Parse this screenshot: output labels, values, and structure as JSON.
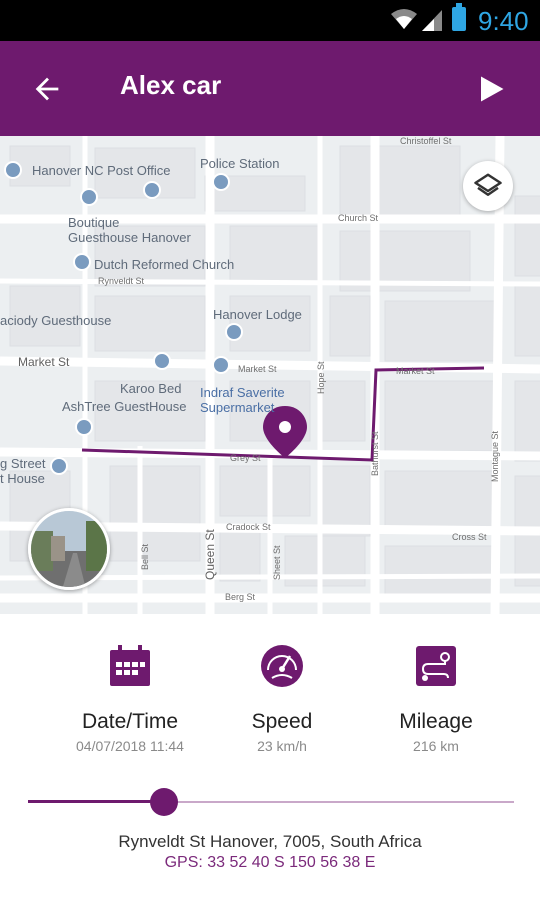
{
  "status_bar": {
    "time": "9:40",
    "icons": [
      "wifi-icon",
      "cell-signal-icon",
      "battery-icon"
    ]
  },
  "app_bar": {
    "title": "Alex car",
    "back_icon": "arrow-left-icon",
    "play_icon": "play-icon",
    "color": "#6e1a6e"
  },
  "map": {
    "layers_icon": "layers-icon",
    "pois": [
      {
        "name": "Hanover NC Post Office"
      },
      {
        "name": "Police Station"
      },
      {
        "name": "Boutique\nGuesthouse Hanover"
      },
      {
        "name": "Dutch Reformed Church"
      },
      {
        "name": "Hanover Lodge"
      },
      {
        "name": "aciody Guesthouse"
      },
      {
        "name": "Karoo Bed"
      },
      {
        "name": "AshTree GuestHouse"
      },
      {
        "name": "Indraf Saverite\nSupermarket"
      },
      {
        "name": "g Street\nt House"
      }
    ],
    "streets": [
      "Christoffel St",
      "Church St",
      "Rynveldt St",
      "Market St",
      "Market St",
      "Market St",
      "Hope St",
      "Queen St",
      "Bathurst St",
      "Montague St",
      "Cradock St",
      "Cross St",
      "Bell St",
      "Sheet St",
      "Berg St",
      "Grey St"
    ]
  },
  "stats": [
    {
      "label": "Date/Time",
      "value": "04/07/2018 11:44",
      "icon": "calendar-icon"
    },
    {
      "label": "Speed",
      "value": "23 km/h",
      "icon": "speedometer-icon"
    },
    {
      "label": "Mileage",
      "value": "216 km",
      "icon": "route-icon"
    }
  ],
  "playback": {
    "position": 0.28
  },
  "location": {
    "address": "Rynveldt St Hanover, 7005, South Africa",
    "gps": "GPS: 33 52 40 S 150 56 38 E"
  },
  "colors": {
    "accent": "#6e1a6e",
    "track_light": "#c9a8c9",
    "gps_text": "#7b2a7b"
  }
}
